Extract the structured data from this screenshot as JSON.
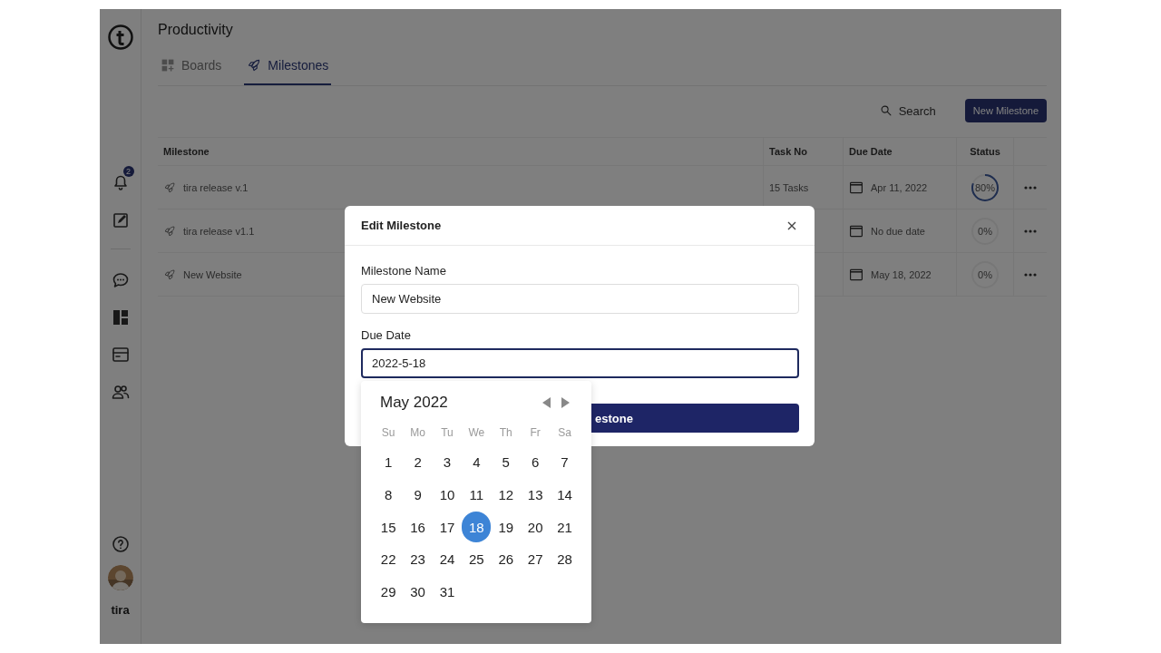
{
  "sidebar": {
    "notification_count": "2",
    "user_name": "tira"
  },
  "page": {
    "title": "Productivity"
  },
  "tabs": [
    {
      "label": "Boards",
      "selected": false
    },
    {
      "label": "Milestones",
      "selected": true
    }
  ],
  "toolbar": {
    "search": "Search",
    "new_button": "New Milestone"
  },
  "table": {
    "columns": [
      "Milestone",
      "Task No",
      "Due Date",
      "Status"
    ],
    "rows": [
      {
        "name": "tira release v.1",
        "tasks": "15 Tasks",
        "due": "Apr 11, 2022",
        "status": "80%"
      },
      {
        "name": "tira release v1.1",
        "tasks": "",
        "due": "No due date",
        "status": "0%"
      },
      {
        "name": "New Website",
        "tasks": "",
        "due": "May 18, 2022",
        "status": "0%"
      }
    ]
  },
  "dialog": {
    "title": "Edit Milestone",
    "name_label": "Milestone Name",
    "name_value": "New Website",
    "date_label": "Due Date",
    "date_value": "2022-5-18",
    "submit_visible_text": "estone"
  },
  "calendar": {
    "month": "May 2022",
    "weekdays": [
      "Su",
      "Mo",
      "Tu",
      "We",
      "Th",
      "Fr",
      "Sa"
    ],
    "days": [
      {
        "d": "1",
        "selected": false
      },
      {
        "d": "2",
        "selected": false
      },
      {
        "d": "3",
        "selected": false
      },
      {
        "d": "4",
        "selected": false
      },
      {
        "d": "5",
        "selected": false
      },
      {
        "d": "6",
        "selected": false
      },
      {
        "d": "7",
        "selected": false
      },
      {
        "d": "8",
        "selected": false
      },
      {
        "d": "9",
        "selected": false
      },
      {
        "d": "10",
        "selected": false
      },
      {
        "d": "11",
        "selected": false
      },
      {
        "d": "12",
        "selected": false
      },
      {
        "d": "13",
        "selected": false
      },
      {
        "d": "14",
        "selected": false
      },
      {
        "d": "15",
        "selected": false
      },
      {
        "d": "16",
        "selected": false
      },
      {
        "d": "17",
        "selected": false
      },
      {
        "d": "18",
        "selected": true
      },
      {
        "d": "19",
        "selected": false
      },
      {
        "d": "20",
        "selected": false
      },
      {
        "d": "21",
        "selected": false
      },
      {
        "d": "22",
        "selected": false
      },
      {
        "d": "23",
        "selected": false
      },
      {
        "d": "24",
        "selected": false
      },
      {
        "d": "25",
        "selected": false
      },
      {
        "d": "26",
        "selected": false
      },
      {
        "d": "27",
        "selected": false
      },
      {
        "d": "28",
        "selected": false
      },
      {
        "d": "29",
        "selected": false
      },
      {
        "d": "30",
        "selected": false
      },
      {
        "d": "31",
        "selected": false
      }
    ]
  }
}
